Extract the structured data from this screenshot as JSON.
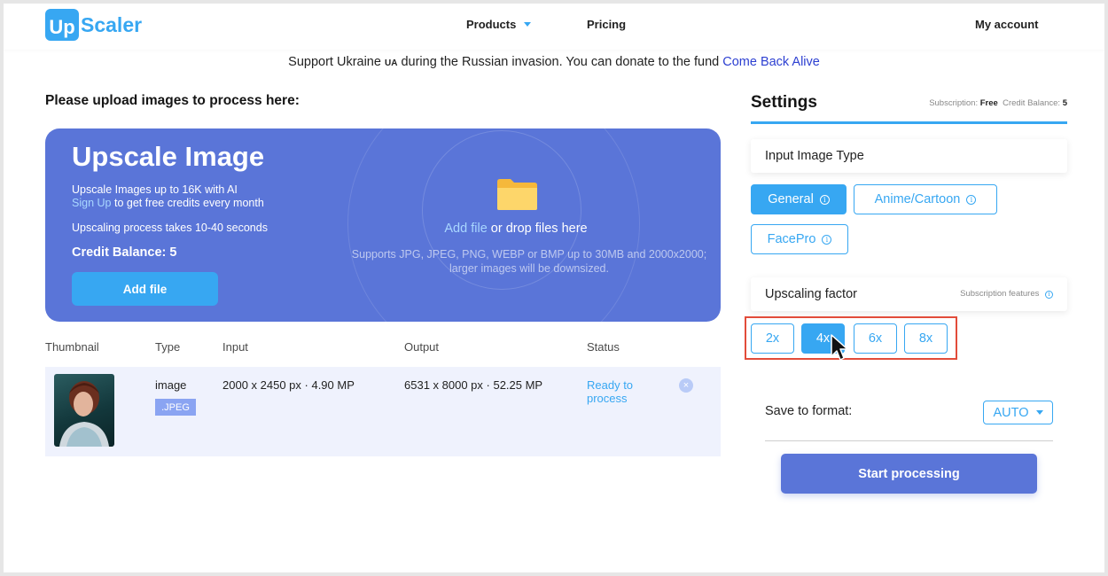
{
  "header": {
    "logo_box_text": "Up",
    "logo_text": "Scaler",
    "nav": {
      "products": "Products",
      "pricing": "Pricing",
      "account": "My account"
    }
  },
  "banner": {
    "text": "Support Ukraine",
    "flag": "UA",
    "text2": "during the Russian invasion. You can donate to the fund",
    "link": "Come Back Alive"
  },
  "upload": {
    "section_title": "Please upload images to process here:",
    "heading": "Upscale Image",
    "line1": "Upscale Images up to 16K with AI",
    "signup_link": "Sign Up",
    "line2": "to get free credits every month",
    "line3": "Upscaling process takes 10-40 seconds",
    "credit": "Credit Balance: 5",
    "add_file_button": "Add file",
    "drop_link": "Add file",
    "drop_text": "or drop files here",
    "drop_sub1": "Supports JPG, JPEG, PNG, WEBP or BMP up to 30MB and 2000x2000;",
    "drop_sub2": "larger images will be downsized."
  },
  "table": {
    "headers": [
      "Thumbnail",
      "Type",
      "Input",
      "Output",
      "Status"
    ],
    "rows": [
      {
        "type": "image",
        "format": ".JPEG",
        "input": "2000 x 2450 px · 4.90 MP",
        "output": "6531 x 8000 px · 52.25 MP",
        "status_line1": "Ready to",
        "status_line2": "process",
        "remove": "×"
      }
    ]
  },
  "settings": {
    "title": "Settings",
    "subscription_label": "Subscription:",
    "subscription_value": "Free",
    "credit_label": "Credit Balance:",
    "credit_value": "5",
    "input_type_label": "Input Image Type",
    "input_types": [
      "General",
      "Anime/Cartoon",
      "FacePro"
    ],
    "selected_input_type": "General",
    "factor_label": "Upscaling factor",
    "factor_note": "Subscription features",
    "factors": [
      "2x",
      "4x",
      "6x",
      "8x"
    ],
    "selected_factor": "4x",
    "save_label": "Save to format:",
    "format_value": "AUTO",
    "start_button": "Start processing"
  },
  "colors": {
    "accent": "#37a7f2",
    "panel": "#5a75d8",
    "highlight_box": "#e24c3a"
  },
  "icons": [
    "folder-icon",
    "info-icon",
    "chevron-down-icon",
    "close-icon",
    "cursor-pointer-icon"
  ]
}
